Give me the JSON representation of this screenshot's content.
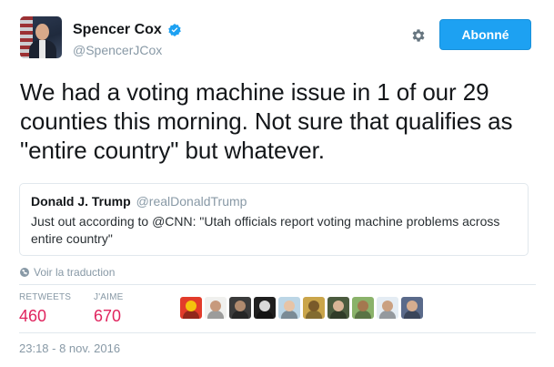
{
  "author": {
    "name": "Spencer Cox",
    "handle": "@SpencerJCox",
    "follow_label": "Abonné"
  },
  "tweet": {
    "text": "We had a voting machine issue in 1 of our 29 counties this morning. Not sure that qualifies as \"entire country\" but whatever."
  },
  "quote": {
    "name": "Donald J. Trump",
    "handle": "@realDonaldTrump",
    "text": "Just out according to @CNN: \"Utah officials report voting machine problems across entire country\""
  },
  "translate_label": "Voir la traduction",
  "stats": {
    "retweets_label": "RETWEETS",
    "retweets_value": "460",
    "likes_label": "J'AIME",
    "likes_value": "670"
  },
  "likers": [
    {
      "bg": "#e23b2a",
      "fg": "#f4c20d"
    },
    {
      "bg": "#f0f0ee",
      "fg": "#c79a7d"
    },
    {
      "bg": "#3b3b3b",
      "fg": "#b08a6e"
    },
    {
      "bg": "#1f1f1f",
      "fg": "#d9d9d9"
    },
    {
      "bg": "#bcd6e6",
      "fg": "#e7c4a6"
    },
    {
      "bg": "#caa54a",
      "fg": "#7a5a2a"
    },
    {
      "bg": "#4b5b3e",
      "fg": "#d9b496"
    },
    {
      "bg": "#8ab26a",
      "fg": "#a4784f"
    },
    {
      "bg": "#e4ecf3",
      "fg": "#caa080"
    },
    {
      "bg": "#5a6a8a",
      "fg": "#d6ad8f"
    }
  ],
  "timestamp": "23:18 - 8 nov. 2016",
  "colors": {
    "accent": "#1da1f2",
    "like_count": "#e0245e",
    "muted": "#8899a6"
  }
}
